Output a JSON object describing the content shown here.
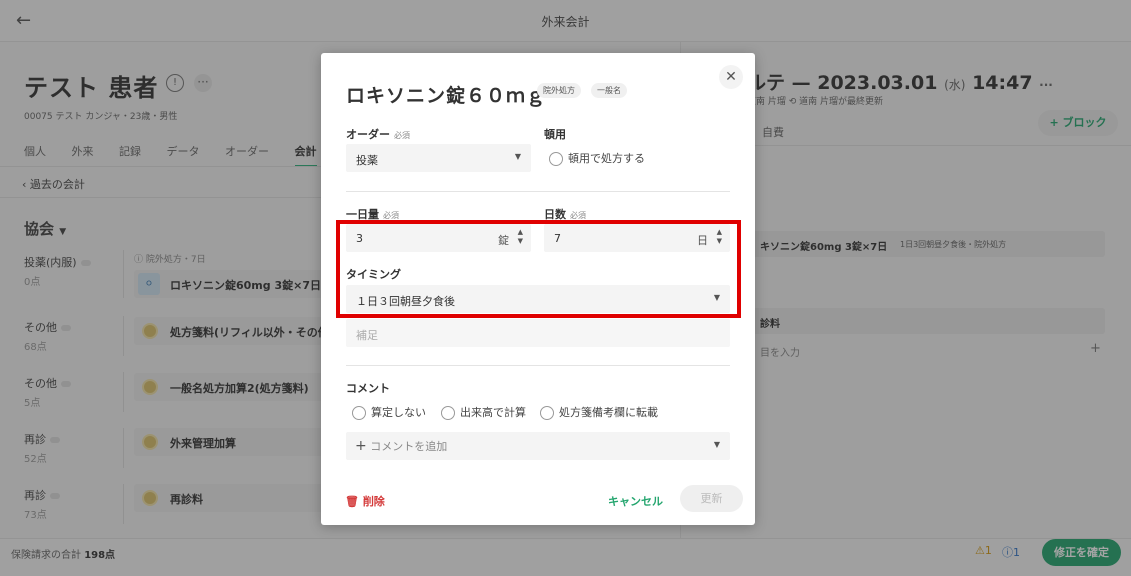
{
  "header": {
    "title": "外来会計",
    "back_icon": "arrow-left-icon"
  },
  "patient": {
    "name": "テスト 患者",
    "info": "00075  テスト カンジャ・23歳・男性"
  },
  "tabs": [
    "個人",
    "外来",
    "記録",
    "データ",
    "オーダー",
    "会計"
  ],
  "active_tab": "会計",
  "past_bills": "過去の会計",
  "insurer": "協会",
  "categories": [
    {
      "name": "投薬(内服)",
      "points": "0点"
    },
    {
      "name": "その他",
      "points": "68点"
    },
    {
      "name": "その他",
      "points": "5点"
    },
    {
      "name": "再診",
      "points": "52点"
    },
    {
      "name": "再診",
      "points": "73点"
    }
  ],
  "items": [
    {
      "note": "院外処方・7日",
      "text": "ロキソニン錠60mg   3錠×7日"
    },
    {
      "text": "処方箋料(リフィル以外・その他)"
    },
    {
      "text": "一般名処方加算2(処方箋料)"
    },
    {
      "text": "外来管理加算"
    },
    {
      "text": "再診料"
    }
  ],
  "footer": {
    "total_label": "保険請求の合計",
    "total_value": "198点",
    "warn_count": "1",
    "info_count": "1",
    "confirm": "修正を確定"
  },
  "karte": {
    "title_suffix": "ルテ — 2023.03.01",
    "weekday": "(水)",
    "time": "14:47",
    "author": "道南 片瑠",
    "updated": "道南 片瑠が最終更新",
    "block_button": "+ ブロック",
    "tab": "自費",
    "med_summary": "キソニン錠60mg   3錠×7日",
    "med_detail": "1日3回朝昼夕食後・院外処方",
    "section": "診料",
    "input_placeholder": "目を入力"
  },
  "modal": {
    "title": "ロキソニン錠６０ｍｇ",
    "badges": [
      "院外処方",
      "一般名"
    ],
    "order_label": "オーダー",
    "required": "必須",
    "order_value": "投薬",
    "prn_label": "頓用",
    "prn_option": "頓用で処方する",
    "daily_label": "一日量",
    "daily_value": "3",
    "daily_unit": "錠",
    "days_label": "日数",
    "days_value": "7",
    "days_unit": "日",
    "timing_label": "タイミング",
    "timing_value": "１日３回朝昼夕食後",
    "supplement_placeholder": "補足",
    "comment_label": "コメント",
    "comment_options": [
      "算定しない",
      "出来高で計算",
      "処方箋備考欄に転載"
    ],
    "add_comment": "コメントを追加",
    "delete": "削除",
    "cancel": "キャンセル",
    "update": "更新"
  },
  "colors": {
    "accent": "#23a56e",
    "highlight": "#e00000",
    "warning": "#d49a12",
    "info": "#2f73c6"
  }
}
